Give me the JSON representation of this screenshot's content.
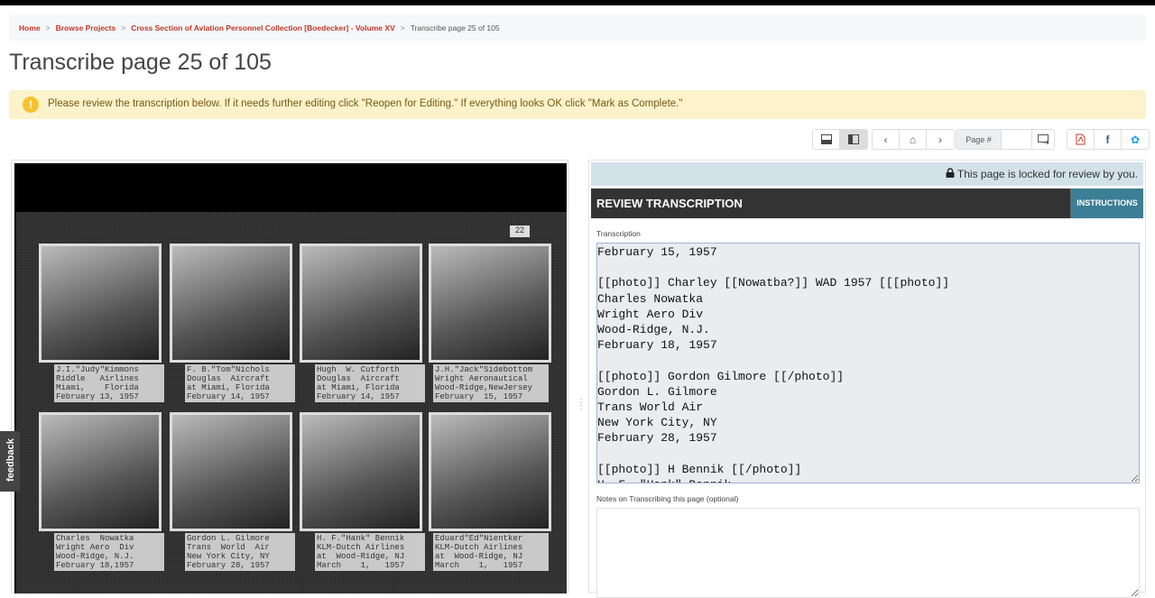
{
  "breadcrumb": {
    "items": [
      "Home",
      "Browse Projects",
      "Cross Section of Aviation Personnel Collection [Boedecker] - Volume XV"
    ],
    "current": "Transcribe page 25 of 105",
    "sep": ">"
  },
  "page_title": "Transcribe page 25 of 105",
  "alert": {
    "icon": "exclamation-icon",
    "glyph": "!",
    "text": "Please review the transcription below. If it needs further editing click \"Reopen for Editing.\" If everything looks OK click \"Mark as Complete.\""
  },
  "toolbar": {
    "page_label": "Page #",
    "page_value": ""
  },
  "image": {
    "page_number": "22",
    "captions": [
      "J.I.\"Judy\"Kimmons\nRiddle   Airlines\nMiami,    Florida\nFebruary 13, 1957",
      "F. B.\"Tom\"Nichols\nDouglas  Aircraft\nat Miami, Florida\nFebruary 14, 1957",
      "Hugh  W. Cutforth\nDouglas  Aircraft\nat Miami, Florida\nFebruary 14, 1957",
      "J.H.\"Jack\"Sidebottom\nWright Aeronautical\nWood-Ridge,NewJersey\nFebruary  15, 1957",
      "Charles  Nowatka\nWright Aero  Div\nWood-Ridge, N.J.\nFebruary 18,1957",
      "Gordon L. Gilmore\nTrans  World  Air\nNew York City, NY\nFebruary 28, 1957",
      "H. F.\"Hank\" Bennik\nKLM-Dutch Airlines\nat  Wood-Ridge, NJ\nMarch    1,   1957",
      "Eduard\"Ed\"Nientker\nKLM-Dutch Airlines\nat  Wood-Ridge, NJ\nMarch    1,   1957"
    ]
  },
  "feedback": "feedback",
  "review": {
    "lock_text": "This page is locked for review by you.",
    "header": "REVIEW TRANSCRIPTION",
    "instructions": "INSTRUCTIONS",
    "transcription_label": "Transcription",
    "transcription": "February 15, 1957\n\n[[photo]] Charley [[Nowatba?]] WAD 1957 [[[photo]]\nCharles Nowatka\nWright Aero Div\nWood-Ridge, N.J.\nFebruary 18, 1957\n\n[[photo]] Gordon Gilmore [[/photo]]\nGordon L. Gilmore\nTrans World Air\nNew York City, NY\nFebruary 28, 1957\n\n[[photo]] H Bennik [[/photo]]\nH. F. \"Hank\" Bennik",
    "notes_label": "Notes on Transcribing this page (optional)",
    "notes": ""
  }
}
